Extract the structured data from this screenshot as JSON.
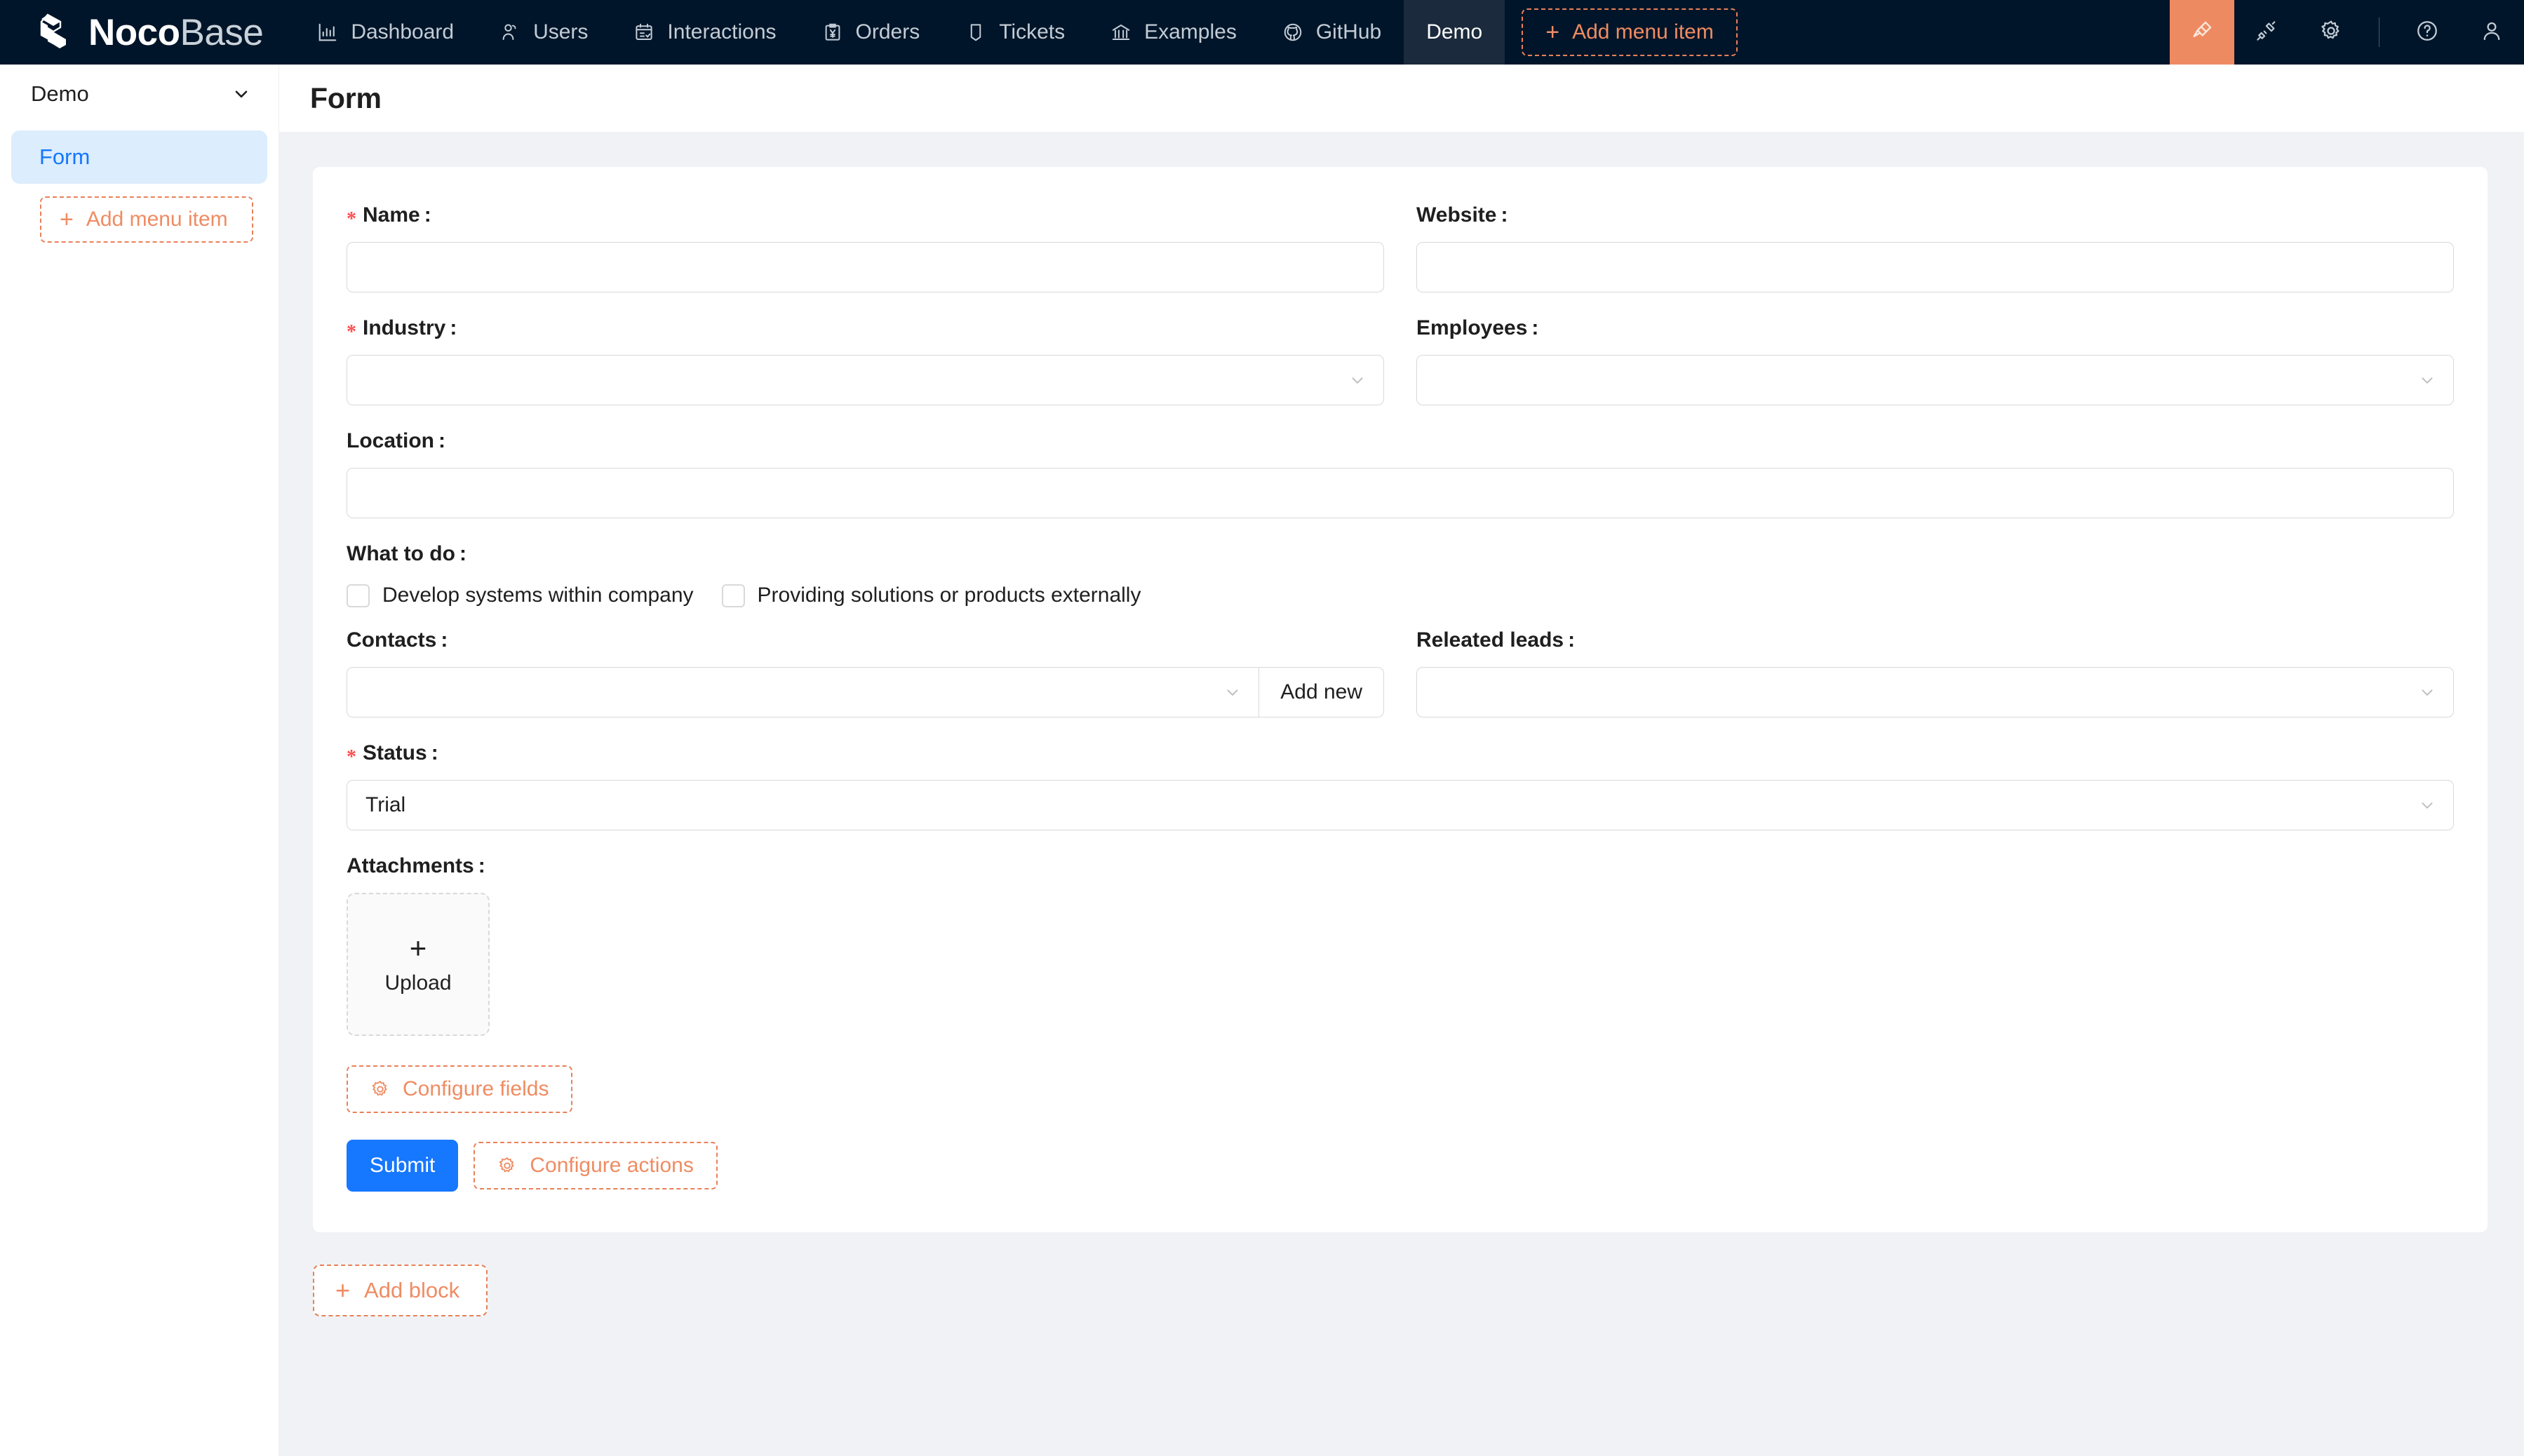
{
  "brand": {
    "name_bold": "Noco",
    "name_light": "Base",
    "logo_icon": "nocobase-cube-logo"
  },
  "topnav": {
    "items": [
      {
        "label": "Dashboard",
        "icon": "bar-chart-icon",
        "active": false
      },
      {
        "label": "Users",
        "icon": "user-group-icon",
        "active": false
      },
      {
        "label": "Interactions",
        "icon": "calendar-check-icon",
        "active": false
      },
      {
        "label": "Orders",
        "icon": "clipboard-yen-icon",
        "active": false
      },
      {
        "label": "Tickets",
        "icon": "ticket-icon",
        "active": false
      },
      {
        "label": "Examples",
        "icon": "bank-icon",
        "active": false
      },
      {
        "label": "GitHub",
        "icon": "github-icon",
        "active": false
      },
      {
        "label": "Demo",
        "icon": "",
        "active": true
      }
    ],
    "add_menu_item": {
      "label": "Add menu item",
      "plus": "+"
    },
    "right_icons": [
      {
        "name": "highlighter-icon",
        "highlighted": true
      },
      {
        "name": "plugin-icon",
        "highlighted": false
      },
      {
        "name": "gear-icon",
        "highlighted": false
      },
      {
        "name": "help-circle-icon",
        "highlighted": false
      },
      {
        "name": "user-avatar-icon",
        "highlighted": false
      }
    ]
  },
  "sidebar": {
    "header_label": "Demo",
    "items": [
      {
        "label": "Form",
        "selected": true
      }
    ],
    "add_menu_item": {
      "label": "Add menu item",
      "plus": "+"
    }
  },
  "page": {
    "title": "Form"
  },
  "form": {
    "name": {
      "label": "Name",
      "colon": ":",
      "required": true,
      "value": "",
      "placeholder": ""
    },
    "website": {
      "label": "Website",
      "colon": ":",
      "required": false,
      "value": "",
      "placeholder": ""
    },
    "industry": {
      "label": "Industry",
      "colon": ":",
      "required": true,
      "value": "",
      "placeholder": ""
    },
    "employees": {
      "label": "Employees",
      "colon": ":",
      "required": false,
      "value": "",
      "placeholder": ""
    },
    "location": {
      "label": "Location",
      "colon": ":",
      "required": false,
      "value": "",
      "placeholder": ""
    },
    "what_to_do": {
      "label": "What to do",
      "colon": ":",
      "options": [
        {
          "label": "Develop systems within company",
          "checked": false
        },
        {
          "label": "Providing solutions or products externally",
          "checked": false
        }
      ]
    },
    "contacts": {
      "label": "Contacts",
      "colon": ":",
      "value": "",
      "add_new_label": "Add new"
    },
    "releated_leads": {
      "label": "Releated leads",
      "colon": ":",
      "value": ""
    },
    "status": {
      "label": "Status",
      "colon": ":",
      "required": true,
      "value": "Trial"
    },
    "attachments": {
      "label": "Attachments",
      "colon": ":",
      "upload_label": "Upload",
      "upload_plus": "+"
    },
    "configure_fields": {
      "label": "Configure fields",
      "icon": "gear-icon"
    },
    "submit": {
      "label": "Submit"
    },
    "configure_actions": {
      "label": "Configure actions",
      "icon": "gear-icon"
    }
  },
  "add_block": {
    "label": "Add block",
    "plus": "+"
  },
  "colors": {
    "topbar_bg": "#001529",
    "accent_orange": "#ef8c63",
    "highlight_orange": "#ee8a62",
    "primary_blue": "#1677ff",
    "selected_item_bg": "#dcedfd",
    "required_red": "#ff4d4f",
    "page_bg": "#f0f2f5"
  }
}
